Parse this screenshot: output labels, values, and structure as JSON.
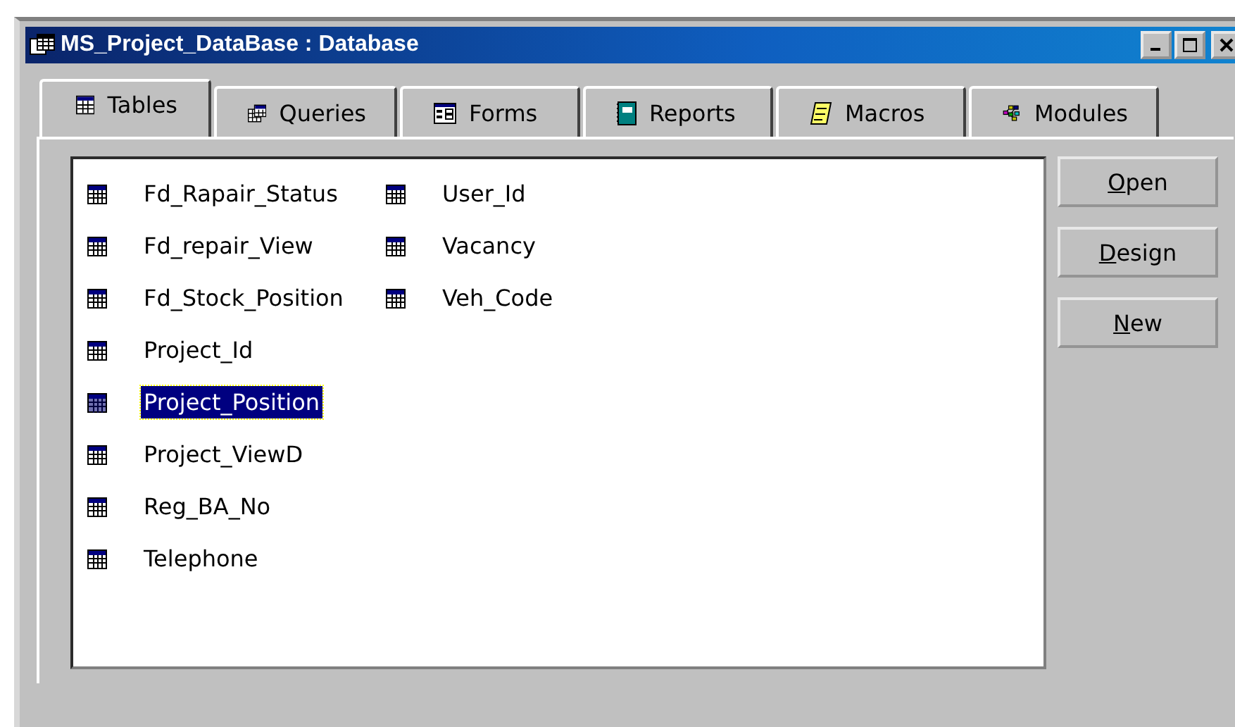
{
  "window": {
    "title": "MS_Project_DataBase : Database"
  },
  "tabs": [
    {
      "label": "Tables",
      "kind": "table",
      "selected": true
    },
    {
      "label": "Queries",
      "kind": "query",
      "selected": false
    },
    {
      "label": "Forms",
      "kind": "form",
      "selected": false
    },
    {
      "label": "Reports",
      "kind": "report",
      "selected": false
    },
    {
      "label": "Macros",
      "kind": "macro",
      "selected": false
    },
    {
      "label": "Modules",
      "kind": "module",
      "selected": false
    }
  ],
  "objects": [
    {
      "name": "Fd_Rapair_Status",
      "selected": false
    },
    {
      "name": "Fd_repair_View",
      "selected": false
    },
    {
      "name": "Fd_Stock_Position",
      "selected": false
    },
    {
      "name": "Project_Id",
      "selected": false
    },
    {
      "name": "Project_Position",
      "selected": true
    },
    {
      "name": "Project_ViewD",
      "selected": false
    },
    {
      "name": "Reg_BA_No",
      "selected": false
    },
    {
      "name": "Telephone",
      "selected": false
    },
    {
      "name": "User_Id",
      "selected": false
    },
    {
      "name": "Vacancy",
      "selected": false
    },
    {
      "name": "Veh_Code",
      "selected": false
    }
  ],
  "buttons": [
    {
      "access_key": "O",
      "rest": "pen"
    },
    {
      "access_key": "D",
      "rest": "esign"
    },
    {
      "access_key": "N",
      "rest": "ew"
    }
  ]
}
